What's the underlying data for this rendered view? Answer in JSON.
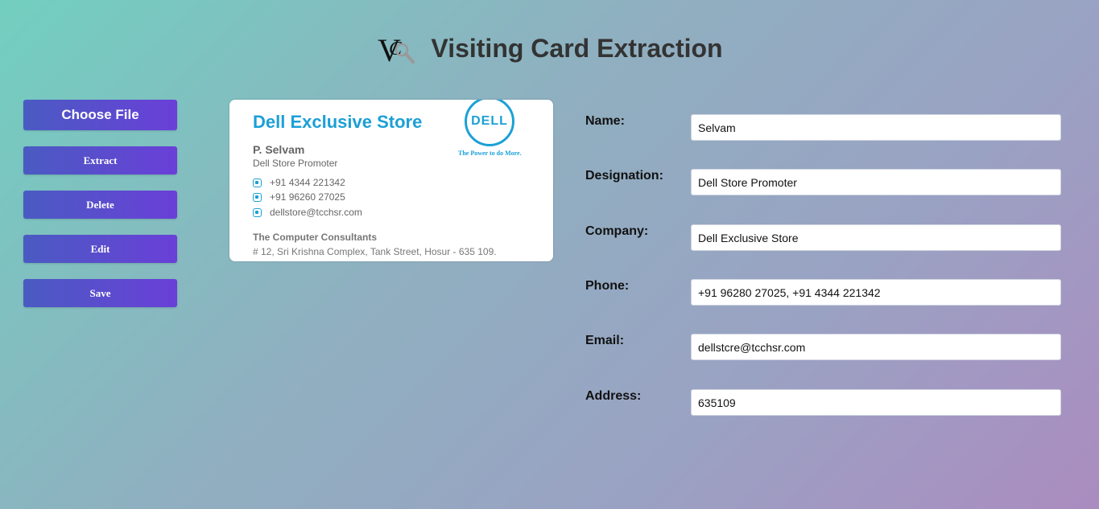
{
  "header": {
    "title": "Visiting Card Extraction"
  },
  "actions": {
    "choose_file": "Choose File",
    "extract": "Extract",
    "delete": "Delete",
    "edit": "Edit",
    "save": "Save"
  },
  "card_image": {
    "company": "Dell Exclusive Store",
    "brand_logo": "DELL",
    "tagline": "The Power to do More.",
    "name": "P. Selvam",
    "role": "Dell Store Promoter",
    "phone1": "+91 4344 221342",
    "phone2": "+91 96260 27025",
    "email": "dellstore@tcchsr.com",
    "org": "The Computer Consultants",
    "address": "# 12, Sri Krishna Complex, Tank Street, Hosur - 635 109."
  },
  "form": {
    "name": {
      "label": "Name:",
      "value": "Selvam"
    },
    "designation": {
      "label": "Designation:",
      "value": "Dell Store Promoter"
    },
    "company": {
      "label": "Company:",
      "value": "Dell Exclusive Store"
    },
    "phone": {
      "label": "Phone:",
      "value": "+91 96280 27025, +91 4344 221342"
    },
    "email": {
      "label": "Email:",
      "value": "dellstcre@tcchsr.com"
    },
    "address": {
      "label": "Address:",
      "value": "635109"
    }
  }
}
